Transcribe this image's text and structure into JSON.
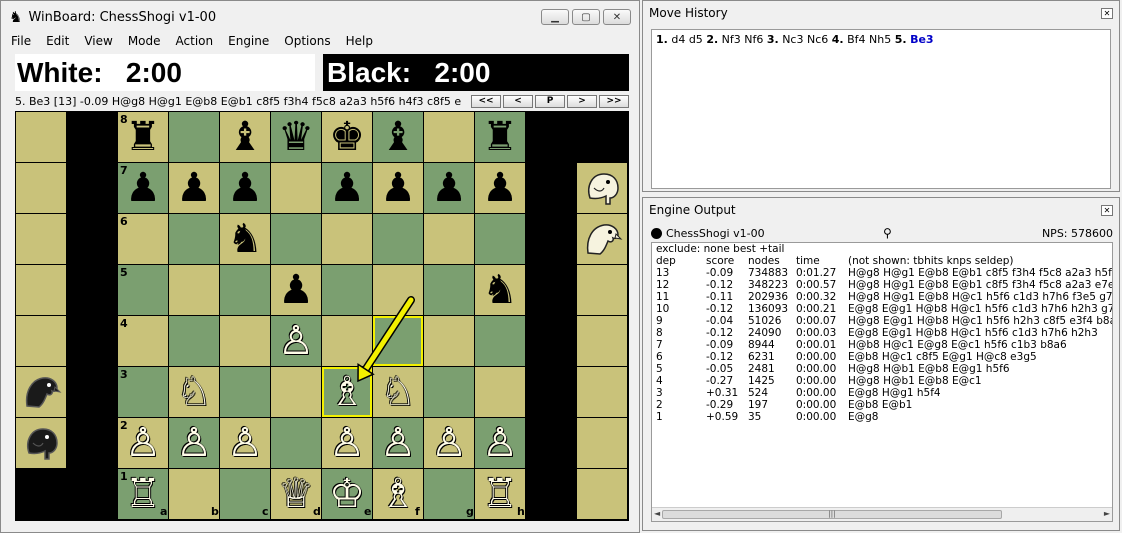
{
  "window": {
    "title": "WinBoard: ChessShogi v1-00",
    "menu": [
      "File",
      "Edit",
      "View",
      "Mode",
      "Action",
      "Engine",
      "Options",
      "Help"
    ]
  },
  "clocks": {
    "white": "White:   2:00",
    "black": "Black:   2:00"
  },
  "message": "5. Be3  [13] -0.09 H@g8 H@g1 E@b8 E@b1 c8f5 f3h4 f5c8 a2a3 h5f6 h4f3 c8f5 e",
  "nav_buttons": [
    "<<",
    "<",
    "P",
    ">",
    ">>"
  ],
  "board": {
    "ranks": [
      "8",
      "7",
      "6",
      "5",
      "4",
      "3",
      "2",
      "1"
    ],
    "files": [
      "a",
      "b",
      "c",
      "d",
      "e",
      "f",
      "g",
      "h"
    ],
    "highlight_squares": [
      "e3",
      "f4"
    ],
    "arrow": {
      "from": "f4",
      "to": "e3"
    },
    "pieces": [
      {
        "sq": "a8",
        "p": "♜",
        "c": "b"
      },
      {
        "sq": "c8",
        "p": "♝",
        "c": "b"
      },
      {
        "sq": "d8",
        "p": "♛",
        "c": "b"
      },
      {
        "sq": "e8",
        "p": "♚",
        "c": "b"
      },
      {
        "sq": "f8",
        "p": "♝",
        "c": "b"
      },
      {
        "sq": "h8",
        "p": "♜",
        "c": "b"
      },
      {
        "sq": "a7",
        "p": "♟",
        "c": "b"
      },
      {
        "sq": "b7",
        "p": "♟",
        "c": "b"
      },
      {
        "sq": "c7",
        "p": "♟",
        "c": "b"
      },
      {
        "sq": "e7",
        "p": "♟",
        "c": "b"
      },
      {
        "sq": "f7",
        "p": "♟",
        "c": "b"
      },
      {
        "sq": "g7",
        "p": "♟",
        "c": "b"
      },
      {
        "sq": "h7",
        "p": "♟",
        "c": "b"
      },
      {
        "sq": "c6",
        "p": "♞",
        "c": "b"
      },
      {
        "sq": "d5",
        "p": "♟",
        "c": "b"
      },
      {
        "sq": "h5",
        "p": "♞",
        "c": "b"
      },
      {
        "sq": "d4",
        "p": "♙",
        "c": "w"
      },
      {
        "sq": "b3",
        "p": "♘",
        "c": "w"
      },
      {
        "sq": "e3",
        "p": "♗",
        "c": "w"
      },
      {
        "sq": "f3",
        "p": "♘",
        "c": "w"
      },
      {
        "sq": "a2",
        "p": "♙",
        "c": "w"
      },
      {
        "sq": "b2",
        "p": "♙",
        "c": "w"
      },
      {
        "sq": "c2",
        "p": "♙",
        "c": "w"
      },
      {
        "sq": "e2",
        "p": "♙",
        "c": "w"
      },
      {
        "sq": "f2",
        "p": "♙",
        "c": "w"
      },
      {
        "sq": "g2",
        "p": "♙",
        "c": "w"
      },
      {
        "sq": "h2",
        "p": "♙",
        "c": "w"
      },
      {
        "sq": "a1",
        "p": "♖",
        "c": "w"
      },
      {
        "sq": "d1",
        "p": "♕",
        "c": "w"
      },
      {
        "sq": "e1",
        "p": "♔",
        "c": "w"
      },
      {
        "sq": "f1",
        "p": "♗",
        "c": "w"
      },
      {
        "sq": "h1",
        "p": "♖",
        "c": "w"
      }
    ],
    "hand_white": [
      {
        "name": "eagle",
        "icon": "eagle-icon",
        "color": "b"
      },
      {
        "name": "elephant",
        "icon": "elephant-icon",
        "color": "b"
      }
    ],
    "hand_black": [
      {
        "name": "elephant",
        "icon": "elephant-icon",
        "color": "w"
      },
      {
        "name": "eagle",
        "icon": "eagle-icon",
        "color": "w"
      }
    ],
    "colors": {
      "light": "#c9c27a",
      "dark": "#7b9f70",
      "highlight": "#f3f000"
    }
  },
  "move_history": {
    "title": "Move History",
    "moves": [
      {
        "num": "1.",
        "text": "d4 d5"
      },
      {
        "num": "2.",
        "text": "Nf3 Nf6"
      },
      {
        "num": "3.",
        "text": "Nc3 Nc6"
      },
      {
        "num": "4.",
        "text": "Bf4 Nh5"
      },
      {
        "num": "5.",
        "text": "Be3",
        "current": true
      }
    ]
  },
  "engine_output": {
    "title": "Engine Output",
    "engine": "ChessShogi v1-00",
    "nps": "NPS: 578600",
    "exclude": "exclude: none best +tail",
    "header": {
      "dep": "dep",
      "score": "score",
      "nodes": "nodes",
      "time": "time",
      "pv": "(not shown:  tbhits  knps       seldep)"
    },
    "rows": [
      {
        "dep": "13",
        "score": "-0.09",
        "nodes": "734883",
        "time": "0:01.27",
        "pv": "H@g8 H@g1 E@b8 E@b1 c8f5 f3h4 f5c8 a2a3 h5f6 h"
      },
      {
        "dep": "12",
        "score": "-0.12",
        "nodes": "348223",
        "time": "0:00.57",
        "pv": "H@g8 H@g1 E@b8 E@b1 c8f5 f3h4 f5c8 a2a3 e7e5 h"
      },
      {
        "dep": "11",
        "score": "-0.11",
        "nodes": "202936",
        "time": "0:00.32",
        "pv": "H@g8 H@g1 E@b8 H@c1 h5f6 c1d3 h7h6 f3e5 g7g5"
      },
      {
        "dep": "10",
        "score": "-0.12",
        "nodes": "136093",
        "time": "0:00.21",
        "pv": "E@g8 E@g1 H@b8 H@c1 h5f6 c1d3 h7h6 h2h3 g7g5"
      },
      {
        "dep": "9",
        "score": "-0.04",
        "nodes": "51026",
        "time": "0:00.07",
        "pv": "H@g8 E@g1 H@b8 H@c1 h5f6 h2h3 c8f5 e3f4 b8a6"
      },
      {
        "dep": "8",
        "score": "-0.12",
        "nodes": "24090",
        "time": "0:00.03",
        "pv": "E@g8 E@g1 H@b8 H@c1 h5f6 c1d3 h7h6 h2h3"
      },
      {
        "dep": "7",
        "score": "-0.09",
        "nodes": "8944",
        "time": "0:00.01",
        "pv": "H@b8 H@c1 E@g8 E@c1 h5f6 c1b3 b8a6"
      },
      {
        "dep": "6",
        "score": "-0.12",
        "nodes": "6231",
        "time": "0:00.00",
        "pv": "E@b8 H@c1 c8f5 E@g1 H@c8 e3g5"
      },
      {
        "dep": "5",
        "score": "-0.05",
        "nodes": "2481",
        "time": "0:00.00",
        "pv": "H@g8 H@b1 E@b8 E@g1 h5f6"
      },
      {
        "dep": "4",
        "score": "-0.27",
        "nodes": "1425",
        "time": "0:00.00",
        "pv": "H@g8 H@b1 E@b8 E@c1"
      },
      {
        "dep": "3",
        "score": "+0.31",
        "nodes": "524",
        "time": "0:00.00",
        "pv": "E@g8 H@g1 h5f4"
      },
      {
        "dep": "2",
        "score": "-0.29",
        "nodes": "197",
        "time": "0:00.00",
        "pv": "E@b8 E@b1"
      },
      {
        "dep": "1",
        "score": "+0.59",
        "nodes": "35",
        "time": "0:00.00",
        "pv": "E@g8"
      }
    ]
  }
}
